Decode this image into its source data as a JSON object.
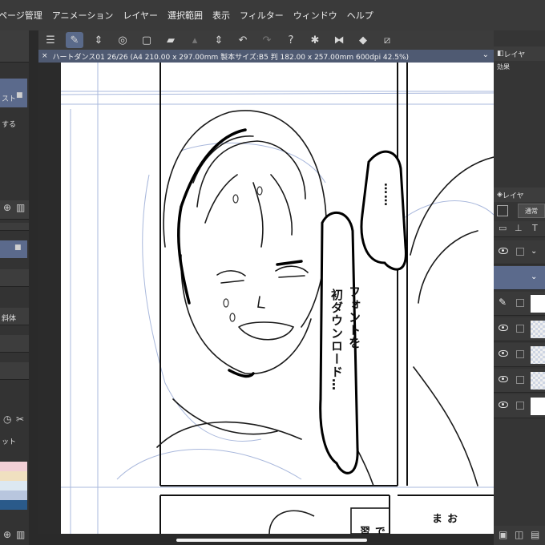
{
  "menubar": {
    "items": [
      "ページ管理",
      "アニメーション",
      "レイヤー",
      "選択範囲",
      "表示",
      "フィルター",
      "ウィンドウ",
      "ヘルプ"
    ]
  },
  "toolbar": {
    "icons": [
      "menu-icon",
      "pen-tool-icon",
      "chevron-updown-icon",
      "spiral-icon",
      "new-page-icon",
      "open-folder-icon",
      "save-icon",
      "chevron-updown-icon",
      "undo-icon",
      "redo-icon",
      "help-icon",
      "brush-settings-icon",
      "flip-horizontal-icon",
      "rotate-icon",
      "transform-icon"
    ]
  },
  "document": {
    "close_glyph": "×",
    "title": "ハートダンス01 26/26 (A4 210.00 x 297.00mm 製本サイズ:B5 判 182.00 x 257.00mm 600dpi 42.5%)"
  },
  "left_panel": {
    "item1": "スト",
    "item2": "する",
    "italic_label": "斜体",
    "palette_label": "ット"
  },
  "right_panel": {
    "tab1": "レイヤ",
    "effect_label": "効果",
    "tab2": "レイヤ",
    "blend_mode": "通常"
  },
  "canvas": {
    "bubble_text_1": "……",
    "bubble_text_2": "フォントを",
    "bubble_text_3": "初ダウンロード…",
    "bottom_text_1": "おま",
    "bottom_text_2": "で習"
  },
  "colors": {
    "menubar": "#3a3a3a",
    "accent": "#5b6a8c",
    "canvas_bg": "#2b2b2b",
    "paper": "#ffffff"
  }
}
